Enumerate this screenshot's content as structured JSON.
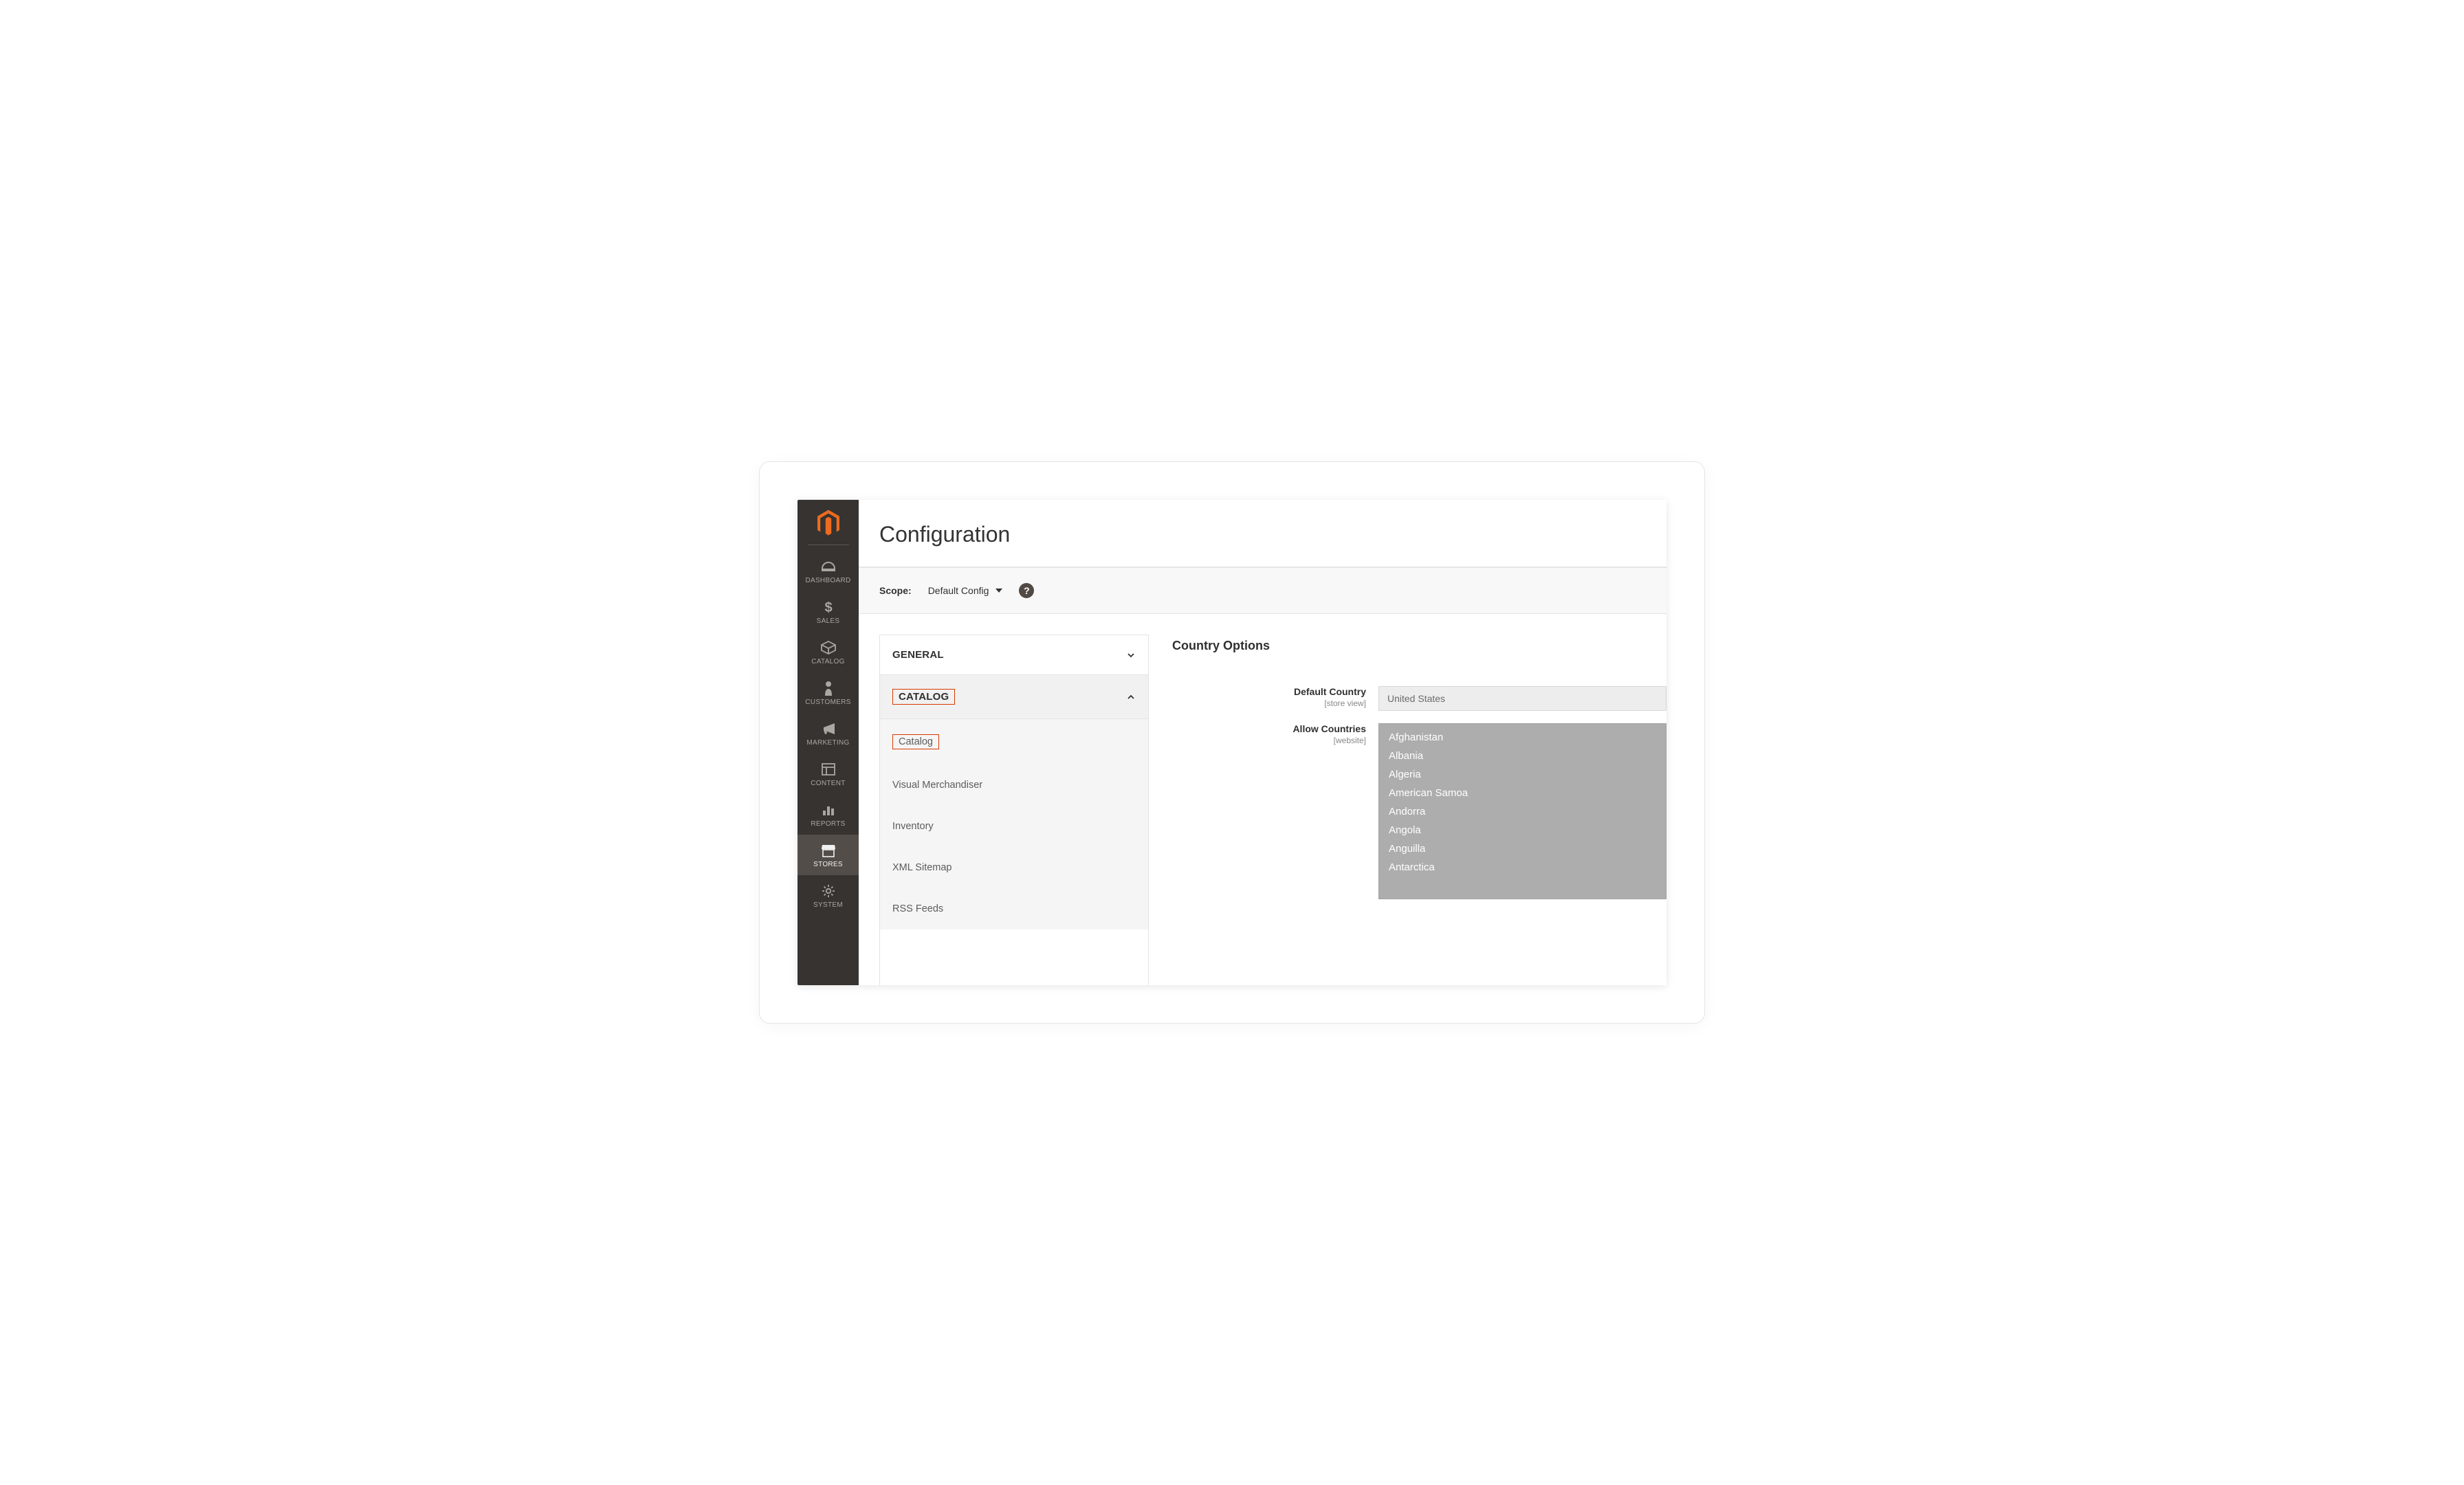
{
  "sidebar": {
    "items": [
      {
        "label": "DASHBOARD"
      },
      {
        "label": "SALES"
      },
      {
        "label": "CATALOG"
      },
      {
        "label": "CUSTOMERS"
      },
      {
        "label": "MARKETING"
      },
      {
        "label": "CONTENT"
      },
      {
        "label": "REPORTS"
      },
      {
        "label": "STORES"
      },
      {
        "label": "SYSTEM"
      }
    ]
  },
  "header": {
    "title": "Configuration"
  },
  "scope": {
    "label": "Scope:",
    "value": "Default Config"
  },
  "configNav": {
    "groups": [
      {
        "label": "GENERAL",
        "expanded": false
      },
      {
        "label": "CATALOG",
        "expanded": true,
        "items": [
          {
            "label": "Catalog"
          },
          {
            "label": "Visual Merchandiser"
          },
          {
            "label": "Inventory"
          },
          {
            "label": "XML Sitemap"
          },
          {
            "label": "RSS Feeds"
          }
        ]
      }
    ]
  },
  "panel": {
    "sectionTitle": "Country Options",
    "defaultCountry": {
      "label": "Default Country",
      "hint": "[store view]",
      "value": "United States"
    },
    "allowCountries": {
      "label": "Allow Countries",
      "hint": "[website]",
      "options": [
        "Afghanistan",
        "Albania",
        "Algeria",
        "American Samoa",
        "Andorra",
        "Angola",
        "Anguilla",
        "Antarctica"
      ]
    }
  }
}
